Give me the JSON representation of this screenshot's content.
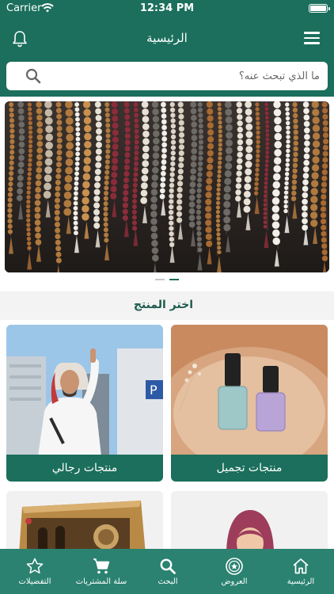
{
  "status_bar": {
    "carrier": "Carrier",
    "time": "12:34 PM",
    "battery_level": 1.0
  },
  "header": {
    "title": "الرئيسية",
    "icons": {
      "left": "bell-icon",
      "right": "menu-icon"
    }
  },
  "search": {
    "placeholder": "ما الذي تبحث عنه؟",
    "value": ""
  },
  "banner": {
    "image": "prayer-beads-photo",
    "slides": 2,
    "active_slide": 1
  },
  "section": {
    "title": "اختر المنتج"
  },
  "products": [
    {
      "label": "منتجات تجميل",
      "image": "nail-polish-photo"
    },
    {
      "label": "منتجات رجالي",
      "image": "man-in-thobe-photo"
    },
    {
      "label": "",
      "image": "woman-in-hijab-photo"
    },
    {
      "label": "",
      "image": "boxed-product-photo"
    }
  ],
  "tabbar": [
    {
      "label": "الرئيسية",
      "icon": "home-icon"
    },
    {
      "label": "العروض",
      "icon": "offers-badge-icon"
    },
    {
      "label": "البحث",
      "icon": "search-icon"
    },
    {
      "label": "سلة المشتريات",
      "icon": "cart-icon"
    },
    {
      "label": "التفضيلات",
      "icon": "star-icon"
    }
  ],
  "colors": {
    "primary": "#1b6f5c",
    "tabbar": "#2b8270",
    "section_bg": "#f3f3f3"
  }
}
